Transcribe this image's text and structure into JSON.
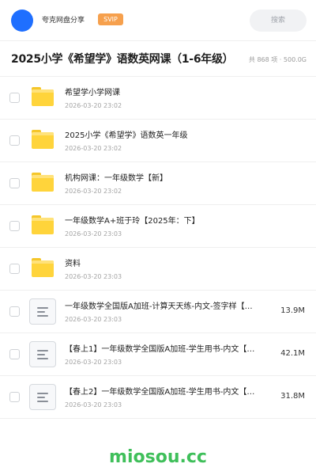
{
  "header": {
    "share_name": "夸克网盘分享",
    "svip_badge": "SVIP",
    "search_placeholder": "搜索",
    "avatar_color": "#1f6fff"
  },
  "folder": {
    "title": "2025小学《希望学》语数英网课（1-6年级）",
    "meta": "共 868 项 · 500.0G"
  },
  "files": [
    {
      "type": "folder",
      "name": "希望学小学网课",
      "date": "2026-03-20 23:02",
      "size": ""
    },
    {
      "type": "folder",
      "name": "2025小学《希望学》语数英一年级",
      "date": "2026-03-20 23:02",
      "size": ""
    },
    {
      "type": "folder",
      "name": "机构网课：一年级数学【新】",
      "date": "2026-03-20 23:02",
      "size": ""
    },
    {
      "type": "folder",
      "name": "一年级数学A+班于玲【2025年：下】",
      "date": "2026-03-20 23:03",
      "size": ""
    },
    {
      "type": "folder",
      "name": "资料",
      "date": "2026-03-20 23:03",
      "size": ""
    },
    {
      "type": "document",
      "name": "一年级数学全国版A加班-计算天天练-内文-签字样【…",
      "date": "2026-03-20 23:03",
      "size": "13.9M"
    },
    {
      "type": "document",
      "name": "【春上1】一年级数学全国版A加班-学生用书-内文【…",
      "date": "2026-03-20 23:03",
      "size": "42.1M"
    },
    {
      "type": "document",
      "name": "【春上2】一年级数学全国版A加班-学生用书-内文【…",
      "date": "2026-03-20 23:03",
      "size": "31.8M"
    }
  ],
  "watermark": "miosou.cc",
  "colors": {
    "folder": "#ffd43b",
    "svip": "#f6a04d",
    "watermark": "#3fbf5a"
  }
}
